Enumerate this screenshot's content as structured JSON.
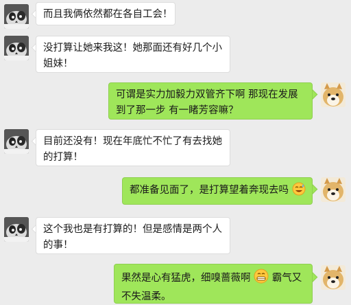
{
  "messages": [
    {
      "side": "in",
      "avatar": "cat-avatar",
      "text": "而且我俩依然都在各自工会！"
    },
    {
      "side": "in",
      "avatar": "cat-avatar",
      "text": "没打算让她来我这！她那面还有好几个小姐妹！"
    },
    {
      "side": "out",
      "avatar": "dog-avatar",
      "text": "可谓是实力加毅力双管齐下啊  那现在发展到了那一步  有一睹芳容嘛？"
    },
    {
      "side": "in",
      "avatar": "cat-avatar",
      "text": "目前还没有！现在年底忙不忙了有去找她的打算！"
    },
    {
      "side": "out",
      "avatar": "dog-avatar",
      "text_before": "都准备见面了，是打算望着奔现去吗",
      "emoji": "sweat-smile-emoji"
    },
    {
      "side": "in",
      "avatar": "cat-avatar",
      "text": "这个我也是有打算的！但是感情是两个人的事！"
    },
    {
      "side": "out",
      "avatar": "dog-avatar",
      "text_before": "果然是心有猛虎，细嗅蔷薇啊",
      "emoji": "grin-emoji",
      "text_after": "霸气又不失温柔。"
    }
  ]
}
